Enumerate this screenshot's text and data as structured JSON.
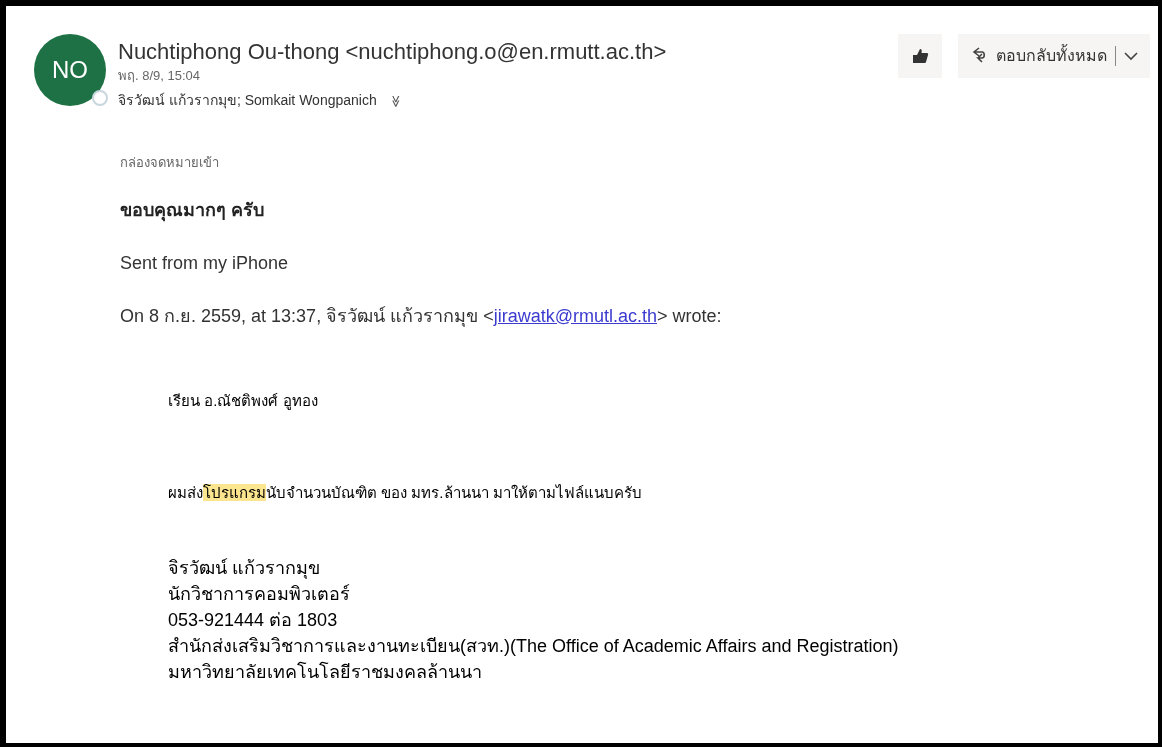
{
  "message": {
    "avatar_initials": "NO",
    "avatar_online": false,
    "sender": "Nuchtiphong Ou-thong <nuchtiphong.o@en.rmutt.ac.th>",
    "date": "พฤ. 8/9, 15:04",
    "recipients": "จิรวัฒน์ แก้วรากมุข; Somkait Wongpanich",
    "expand_icon": "≫"
  },
  "actions": {
    "reply_all": "ตอบกลับทั้งหมด"
  },
  "folder": "กล่องจดหมายเข้า",
  "body": [
    {
      "kind": "bold",
      "text": "ขอบคุณมากๆ ครับ"
    },
    {
      "kind": "plain",
      "text": "Sent from my iPhone"
    }
  ],
  "quote_header": {
    "before": "On 8 ก.ย. 2559, at 13:37, จิรวัฒน์ แก้วรากมุข <",
    "link": "jirawatk@rmutl.ac.th",
    "after": "> wrote:"
  },
  "quoted": {
    "greeting": "เรียน อ.ณัชติพงศ์ อูทอง",
    "sentence": [
      {
        "text": "ผมส่ง",
        "highlighted": false
      },
      {
        "text": "โปรแกรม",
        "highlighted": true
      },
      {
        "text": "นับจำนวนบัณฑิต ของ มทร.ล้านนา มาให้ตามไฟล์แนบครับ",
        "highlighted": false
      }
    ],
    "signature": [
      "จิรวัฒน์ แก้วรากมุข",
      "นักวิชาการคอมพิวเตอร์",
      "053-921444 ต่อ 1803",
      "สำนักส่งเสริมวิชาการและงานทะเบียน(สวท.)(The Office of Academic Affairs and Registration)",
      "มหาวิทยาลัยเทคโนโลยีราชมงคลล้านนา"
    ]
  }
}
